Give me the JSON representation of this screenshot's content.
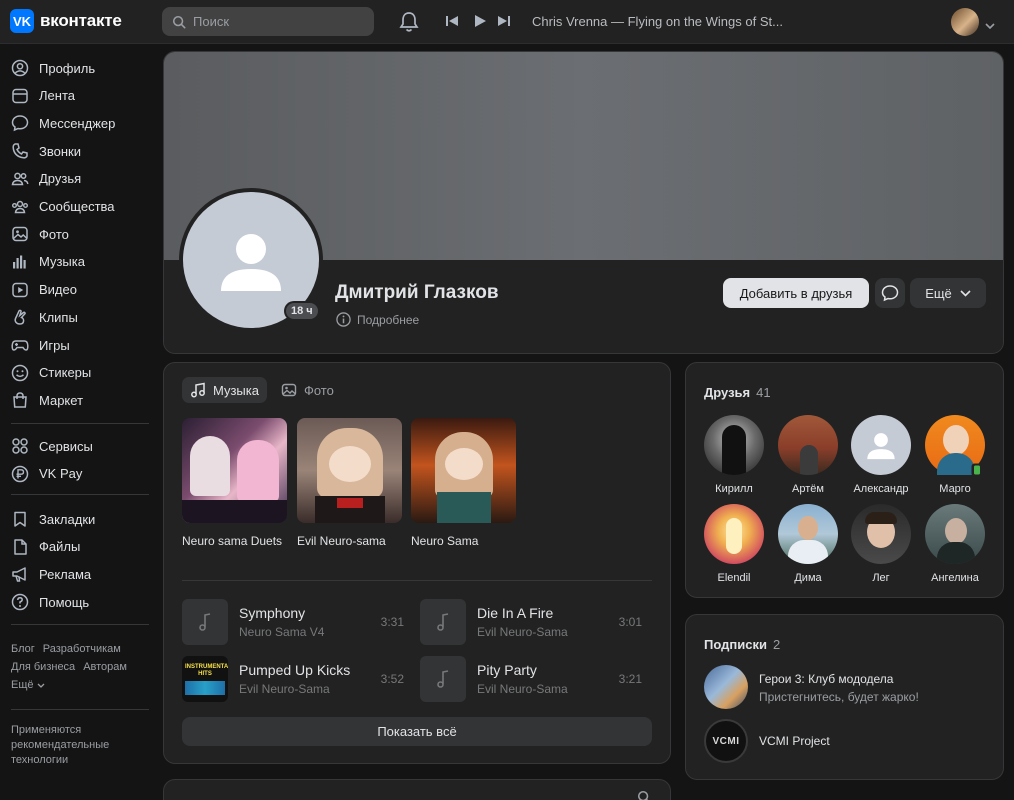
{
  "header": {
    "logo_text": "вконтакте",
    "logo_mark": "VK",
    "search_placeholder": "Поиск",
    "now_playing": "Chris Vrenna — Flying on the Wings of St..."
  },
  "sidebar": {
    "items": [
      {
        "label": "Профиль",
        "icon": "user-circle-icon"
      },
      {
        "label": "Лента",
        "icon": "newsfeed-icon"
      },
      {
        "label": "Мессенджер",
        "icon": "message-icon"
      },
      {
        "label": "Звонки",
        "icon": "phone-icon"
      },
      {
        "label": "Друзья",
        "icon": "friends-icon"
      },
      {
        "label": "Сообщества",
        "icon": "communities-icon"
      },
      {
        "label": "Фото",
        "icon": "photo-icon"
      },
      {
        "label": "Музыка",
        "icon": "music-icon"
      },
      {
        "label": "Видео",
        "icon": "video-icon"
      },
      {
        "label": "Клипы",
        "icon": "clips-icon"
      },
      {
        "label": "Игры",
        "icon": "gamepad-icon"
      },
      {
        "label": "Стикеры",
        "icon": "smile-icon"
      },
      {
        "label": "Маркет",
        "icon": "bag-icon"
      }
    ],
    "items2": [
      {
        "label": "Сервисы",
        "icon": "services-icon"
      },
      {
        "label": "VK Pay",
        "icon": "ruble-icon"
      }
    ],
    "items3": [
      {
        "label": "Закладки",
        "icon": "bookmark-icon"
      },
      {
        "label": "Файлы",
        "icon": "file-icon"
      },
      {
        "label": "Реклама",
        "icon": "megaphone-icon"
      },
      {
        "label": "Помощь",
        "icon": "help-icon"
      }
    ],
    "footer": {
      "blog": "Блог",
      "developers": "Разработчикам",
      "business": "Для бизнеса",
      "authors": "Авторам",
      "more": "Ещё"
    },
    "recommend_text": "Применяются рекомендательные технологии"
  },
  "profile": {
    "name": "Дмитрий Глазков",
    "last_seen": "18 ч",
    "more_label": "Подробнее",
    "add_friend": "Добавить в друзья",
    "more_button": "Ещё"
  },
  "music": {
    "tab_music": "Музыка",
    "tab_photo": "Фото",
    "playlists": [
      {
        "title": "Neuro sama Duets"
      },
      {
        "title": "Evil Neuro-sama"
      },
      {
        "title": "Neuro Sama"
      }
    ],
    "tracks": [
      {
        "title": "Symphony",
        "artist": "Neuro Sama V4",
        "duration": "3:31"
      },
      {
        "title": "Die In A Fire",
        "artist": "Evil Neuro-Sama",
        "duration": "3:01"
      },
      {
        "title": "Pumped Up Kicks",
        "artist": "Evil Neuro-Sama",
        "duration": "3:52",
        "cover_text": "INSTRUMENTAL HITS"
      },
      {
        "title": "Pity Party",
        "artist": "Evil Neuro-Sama",
        "duration": "3:21"
      }
    ],
    "show_all": "Показать всё"
  },
  "friends": {
    "title": "Друзья",
    "count": "41",
    "list": [
      {
        "name": "Кирилл"
      },
      {
        "name": "Артём"
      },
      {
        "name": "Александр"
      },
      {
        "name": "Марго"
      },
      {
        "name": "Elendil"
      },
      {
        "name": "Дима"
      },
      {
        "name": "Лег"
      },
      {
        "name": "Ангелина"
      }
    ]
  },
  "subscriptions": {
    "title": "Подписки",
    "count": "2",
    "list": [
      {
        "name": "Герои 3: Клуб мододела",
        "desc": "Пристегнитесь, будет жарко!"
      },
      {
        "name": "VCMI Project",
        "desc": "",
        "logo_text": "VCMI"
      }
    ]
  },
  "colors": {
    "accent": "#0077ff",
    "background": "#141414",
    "card": "#222222",
    "text": "#e1e3e6",
    "secondary": "#9a9ea3",
    "online": "#4bb34b"
  }
}
